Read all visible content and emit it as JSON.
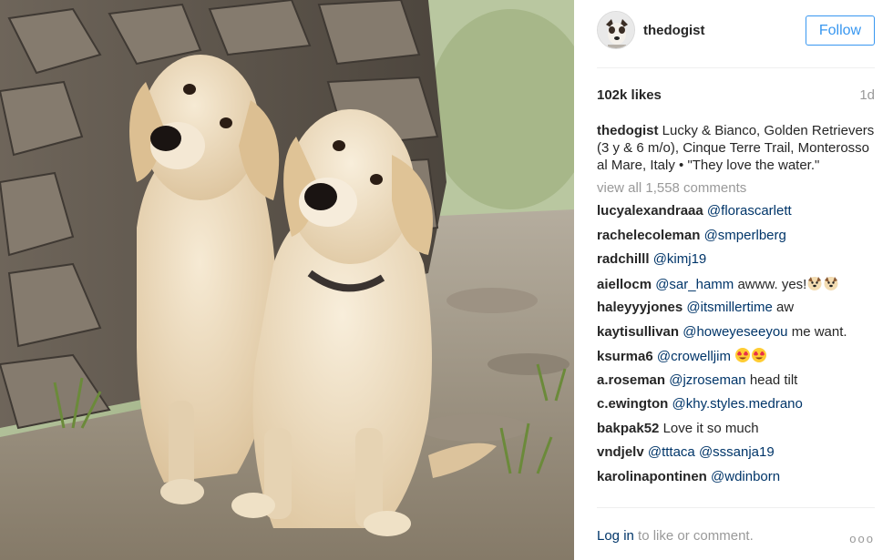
{
  "post": {
    "username": "thedogist",
    "follow_label": "Follow",
    "likes": "102k likes",
    "time": "1d",
    "caption_user": "thedogist",
    "caption_text": "Lucky & Bianco, Golden Retrievers (3 y & 6 m/o), Cinque Terre Trail, Monterosso al Mare, Italy • \"They love the water.\"",
    "view_all": "view all 1,558 comments"
  },
  "comments": [
    {
      "user": "lucyalexandraaa",
      "mention": "@florascarlett",
      "text": ""
    },
    {
      "user": "rachelecoleman",
      "mention": "@smperlberg",
      "text": ""
    },
    {
      "user": "radchilll",
      "mention": "@kimj19",
      "text": ""
    },
    {
      "user": "aiellocm",
      "mention": "@sar_hamm",
      "text": "awww. yes!",
      "emoji": [
        "dog-face",
        "dog-face"
      ]
    },
    {
      "user": "haleyyyjones",
      "mention": "@itsmillertime",
      "text": "aw"
    },
    {
      "user": "kaytisullivan",
      "mention": "@howeyeseeyou",
      "text": "me want."
    },
    {
      "user": "ksurma6",
      "mention": "@crowelljim",
      "text": "",
      "emoji": [
        "heart-eyes",
        "heart-eyes"
      ]
    },
    {
      "user": "a.roseman",
      "mention": "@jzroseman",
      "text": "head tilt"
    },
    {
      "user": "c.ewington",
      "mention": "@khy.styles.medrano",
      "text": ""
    },
    {
      "user": "bakpak52",
      "mention": "",
      "text": "Love it so much"
    },
    {
      "user": "vndjelv",
      "mention": "@tttaca @sssanja19",
      "text": ""
    },
    {
      "user": "karolinapontinen",
      "mention": "@wdinborn",
      "text": ""
    }
  ],
  "footer": {
    "login_label": "Log in",
    "rest": " to like or comment.",
    "more_label": "ooo"
  },
  "colors": {
    "accent": "#3897f0",
    "link": "#003569",
    "muted": "#999999"
  }
}
